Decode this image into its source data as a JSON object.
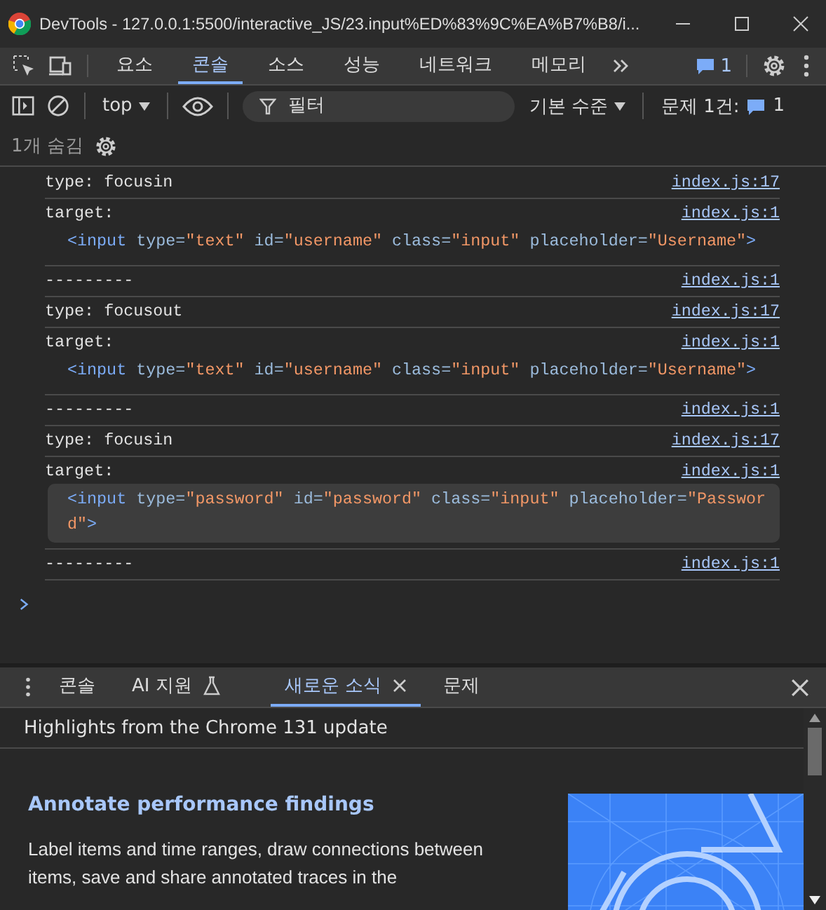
{
  "window": {
    "title": "DevTools - 127.0.0.1:5500/interactive_JS/23.input%ED%83%9C%EA%B7%B8/i..."
  },
  "tabs": [
    {
      "label": "요소",
      "selected": false
    },
    {
      "label": "콘솔",
      "selected": true
    },
    {
      "label": "소스",
      "selected": false
    },
    {
      "label": "성능",
      "selected": false
    },
    {
      "label": "네트워크",
      "selected": false
    },
    {
      "label": "메모리",
      "selected": false
    }
  ],
  "message_count": "1",
  "toolbar": {
    "context": "top",
    "filter": {
      "placeholder": "필터"
    },
    "levels": "기본 수준",
    "issues_label": "문제 1건:",
    "issues_count": "1"
  },
  "hidden_count": "1개 숨김",
  "messages": [
    {
      "kind": "text",
      "text": "type: focusin",
      "source": "index.js:17"
    },
    {
      "kind": "element",
      "text": "target:",
      "source": "index.js:1",
      "highlighted": false,
      "tokens": [
        {
          "kind": "tag",
          "text": "<input"
        },
        {
          "kind": "name",
          "text": " type="
        },
        {
          "kind": "value",
          "text": "\"text\""
        },
        {
          "kind": "name",
          "text": " id="
        },
        {
          "kind": "value",
          "text": "\"username\""
        },
        {
          "kind": "name",
          "text": " class="
        },
        {
          "kind": "value",
          "text": "\"input\""
        },
        {
          "kind": "name",
          "text": " placeholder="
        },
        {
          "kind": "value",
          "text": "\"Username\""
        },
        {
          "kind": "tag",
          "text": ">"
        }
      ]
    },
    {
      "kind": "text",
      "text": "---------",
      "source": "index.js:1"
    },
    {
      "kind": "text",
      "text": "type: focusout",
      "source": "index.js:17"
    },
    {
      "kind": "element",
      "text": "target:",
      "source": "index.js:1",
      "highlighted": false,
      "tokens": [
        {
          "kind": "tag",
          "text": "<input"
        },
        {
          "kind": "name",
          "text": " type="
        },
        {
          "kind": "value",
          "text": "\"text\""
        },
        {
          "kind": "name",
          "text": " id="
        },
        {
          "kind": "value",
          "text": "\"username\""
        },
        {
          "kind": "name",
          "text": " class="
        },
        {
          "kind": "value",
          "text": "\"input\""
        },
        {
          "kind": "name",
          "text": " placeholder="
        },
        {
          "kind": "value",
          "text": "\"Username\""
        },
        {
          "kind": "tag",
          "text": ">"
        }
      ]
    },
    {
      "kind": "text",
      "text": "---------",
      "source": "index.js:1"
    },
    {
      "kind": "text",
      "text": "type: focusin",
      "source": "index.js:17"
    },
    {
      "kind": "element",
      "text": "target:",
      "source": "index.js:1",
      "highlighted": true,
      "tokens": [
        {
          "kind": "tag",
          "text": "<input"
        },
        {
          "kind": "name",
          "text": " type="
        },
        {
          "kind": "value",
          "text": "\"password\""
        },
        {
          "kind": "name",
          "text": " id="
        },
        {
          "kind": "value",
          "text": "\"password\""
        },
        {
          "kind": "name",
          "text": " class="
        },
        {
          "kind": "value",
          "text": "\"input\""
        },
        {
          "kind": "name",
          "text": " placeholder="
        },
        {
          "kind": "value",
          "text": "\"Password\""
        },
        {
          "kind": "tag",
          "text": ">"
        }
      ]
    },
    {
      "kind": "text",
      "text": "---------",
      "source": "index.js:1"
    }
  ],
  "drawer": {
    "tabs": [
      {
        "label": "콘솔",
        "selected": false,
        "kind": "plain"
      },
      {
        "label": "AI 지원",
        "selected": false,
        "kind": "experimental"
      },
      {
        "label": "새로운 소식",
        "selected": true,
        "kind": "closable"
      },
      {
        "label": "문제",
        "selected": false,
        "kind": "plain"
      }
    ],
    "header": "Highlights from the Chrome 131 update",
    "article": {
      "title": "Annotate performance findings",
      "body": "Label items and time ranges, draw connections between items, save and share annotated traces in the",
      "kind": "picture"
    }
  }
}
